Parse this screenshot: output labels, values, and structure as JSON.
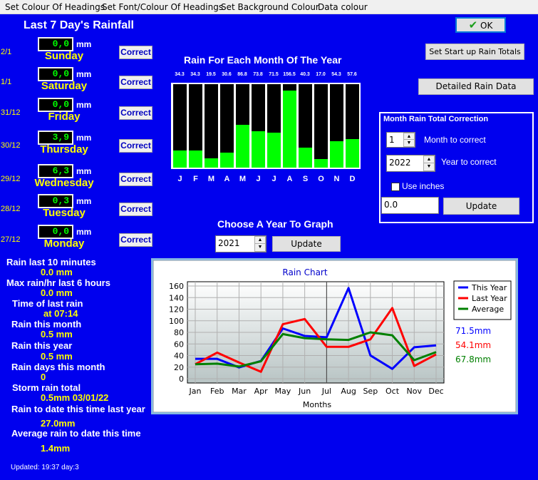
{
  "menu": [
    "Set Colour Of Headings",
    "Set Font/Colour Of Headings",
    "Set Background Colour",
    "Data colour"
  ],
  "ok_label": "OK",
  "seven_day_title": "Last 7 Day's Rainfall",
  "mm_unit": "mm",
  "correct_label": "Correct",
  "days": [
    {
      "date": "2/1",
      "value": "0,0",
      "name": "Sunday"
    },
    {
      "date": "1/1",
      "value": "0,0",
      "name": "Saturday"
    },
    {
      "date": "31/12",
      "value": "0,0",
      "name": "Friday"
    },
    {
      "date": "30/12",
      "value": "3,9",
      "name": "Thursday"
    },
    {
      "date": "29/12",
      "value": "6,3",
      "name": "Wednesday"
    },
    {
      "date": "28/12",
      "value": "0,3",
      "name": "Tuesday"
    },
    {
      "date": "27/12",
      "value": "0,0",
      "name": "Monday"
    }
  ],
  "stats": [
    {
      "label": "Rain last 10 minutes",
      "value": "0.0 mm"
    },
    {
      "label": "Max rain/hr last 6 hours",
      "value": "0.0 mm"
    },
    {
      "label": "Time of last rain",
      "value": "at 07:14"
    },
    {
      "label": "Rain this month",
      "value": "0.5 mm"
    },
    {
      "label": "Rain this year",
      "value": "0.5 mm"
    },
    {
      "label": "Rain days this month",
      "value": "0"
    },
    {
      "label": "Storm rain total",
      "value": "0.5mm 03/01/22"
    },
    {
      "label": "Rain to date this time last year",
      "value": "27.0mm"
    },
    {
      "label": "Average rain to date this time",
      "value": "1.4mm"
    }
  ],
  "updated": "Updated:  19:37 day:3",
  "monthly": {
    "title": "Rain For Each Month Of The Year",
    "letters": [
      "J",
      "F",
      "M",
      "A",
      "M",
      "J",
      "J",
      "A",
      "S",
      "O",
      "N",
      "D"
    ],
    "value_labels": [
      "34.3",
      "34.3",
      "19.5",
      "30.6",
      "86.8",
      "73.8",
      "71.5",
      "156.5",
      "40.3",
      "17.0",
      "54.3",
      "57.6"
    ],
    "values": [
      34.3,
      34.3,
      19.5,
      30.6,
      86.8,
      73.8,
      71.5,
      156.5,
      40.3,
      17.0,
      54.3,
      57.6
    ],
    "max": 170
  },
  "set_startup_label": "Set Start up Rain Totals",
  "detailed_label": "Detailed Rain Data",
  "correction": {
    "title": "Month Rain Total Correction",
    "month_value": "1",
    "month_label": "Month to correct",
    "year_value": "2022",
    "year_label": "Year to correct",
    "inches_label": "Use inches",
    "amount_value": "0.0",
    "update_label": "Update"
  },
  "choose_year": {
    "title": "Choose A Year To Graph",
    "year_value": "2021",
    "update_label": "Update"
  },
  "chart_data": {
    "type": "line",
    "title": "Rain Chart",
    "xlabel": "Months",
    "ylabel": "",
    "categories": [
      "Jan",
      "Feb",
      "Mar",
      "Apr",
      "May",
      "Jun",
      "Jul",
      "Aug",
      "Sep",
      "Oct",
      "Nov",
      "Dec"
    ],
    "ylim": [
      0,
      160
    ],
    "yticks": [
      0,
      20,
      40,
      60,
      80,
      100,
      120,
      140,
      160
    ],
    "grid": true,
    "legend": "top-right",
    "series": [
      {
        "name": "This Year",
        "color": "#0000ff",
        "values": [
          34.3,
          34.3,
          19.5,
          30.6,
          86.8,
          73.8,
          71.5,
          156.5,
          40.3,
          17.0,
          54.3,
          57.6
        ]
      },
      {
        "name": "Last Year",
        "color": "#ff0000",
        "values": [
          25,
          45,
          28,
          12,
          94,
          103,
          55,
          55,
          68,
          122,
          22,
          42
        ]
      },
      {
        "name": "Average",
        "color": "#008000",
        "values": [
          25,
          26,
          21,
          30,
          77,
          70,
          68,
          67,
          80,
          75,
          32,
          46
        ]
      }
    ],
    "totals": [
      {
        "text": "71.5mm",
        "color": "#0000ff"
      },
      {
        "text": "54.1mm",
        "color": "#ff0000"
      },
      {
        "text": "67.8mm",
        "color": "#008000"
      }
    ]
  }
}
